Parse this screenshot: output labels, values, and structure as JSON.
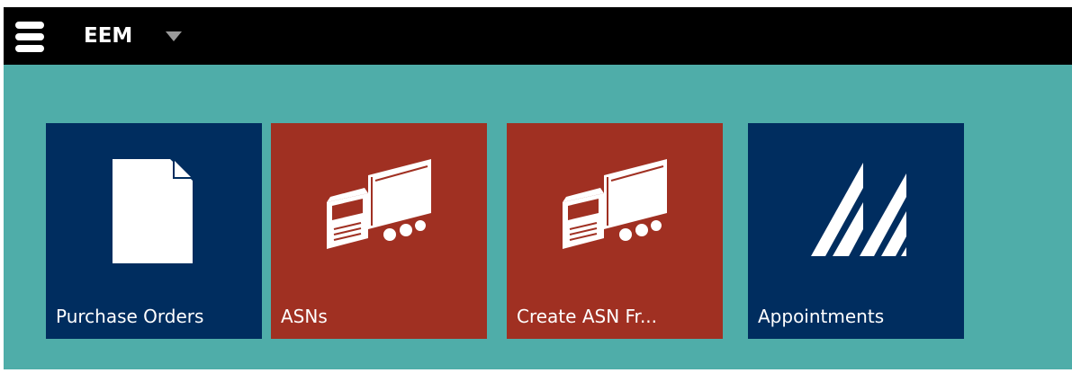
{
  "header": {
    "app_title": "EEM",
    "menu_icon": "hamburger-menu-icon",
    "switcher_icon": "caret-down-icon"
  },
  "tiles": [
    {
      "label": "Purchase Orders",
      "icon": "document-icon",
      "color": "#002d5f"
    },
    {
      "label": "ASNs",
      "icon": "truck-icon",
      "color": "#a03022"
    },
    {
      "label": "Create ASN Fr...",
      "icon": "truck-icon",
      "color": "#a03022"
    },
    {
      "label": "Appointments",
      "icon": "appointments-stripes-icon",
      "color": "#002d5f"
    }
  ],
  "colors": {
    "background": "#4fada9",
    "topbar": "#000000",
    "tile_blue": "#002d5f",
    "tile_red": "#a03022",
    "caret": "#9a9a9a"
  }
}
